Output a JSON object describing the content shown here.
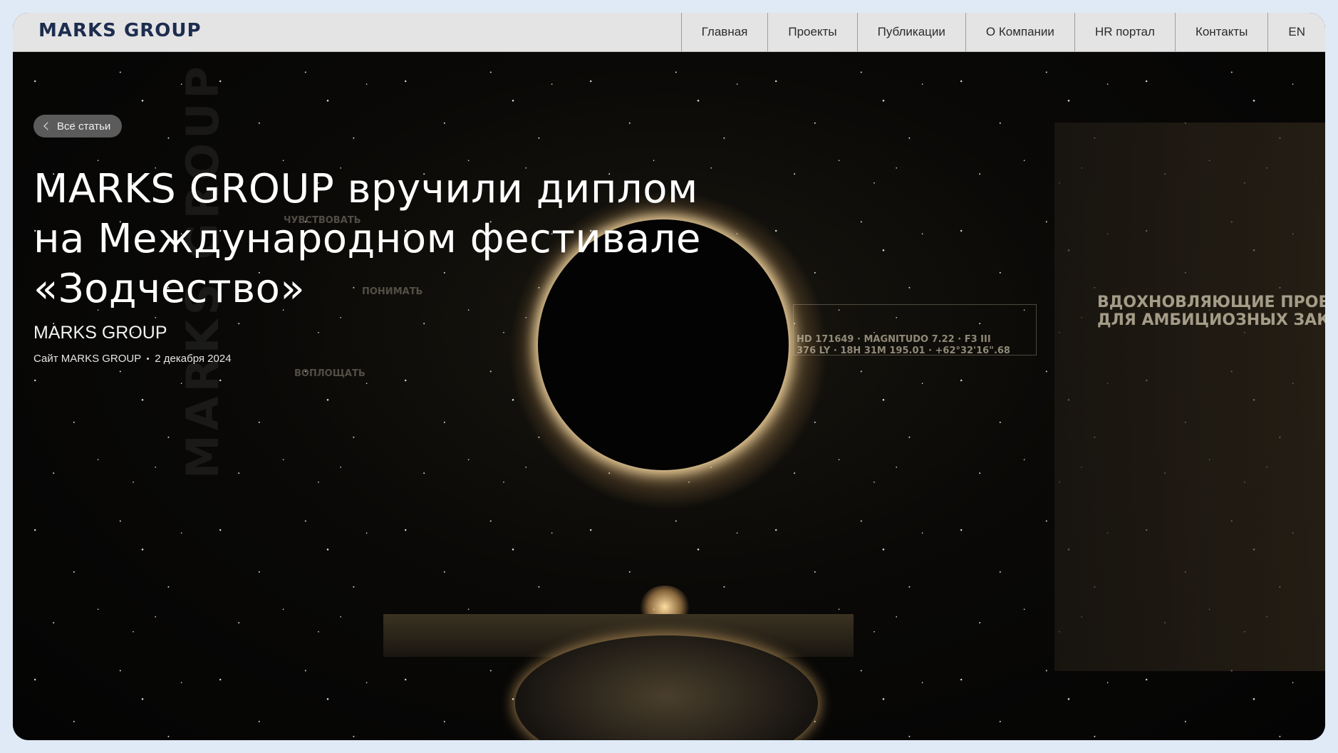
{
  "header": {
    "logo": "MARKS GROUP",
    "nav": [
      {
        "label": "Главная"
      },
      {
        "label": "Проекты"
      },
      {
        "label": "Публикации"
      },
      {
        "label": "О Компании"
      },
      {
        "label": "HR портал"
      },
      {
        "label": "Контакты"
      },
      {
        "label": "EN"
      }
    ]
  },
  "article": {
    "back_label": "Все статьи",
    "back_icon": "chevron-left-icon",
    "title_lines": [
      "MARKS GROUP вручили диплом",
      "на Международном фестивале",
      "«Зодчество»"
    ],
    "author": "MARKS GROUP",
    "source": "Сайт MARKS GROUP",
    "date": "2 декабря 2024"
  },
  "hero_scene": {
    "vertical_logo": "MARKS GROUP",
    "wall_words": [
      "ЧУВСТВОВАТЬ",
      "ПОНИМАТЬ",
      "ВОПЛОЩАТЬ"
    ],
    "hud_lines": [
      "HD 171649 · MAGNITUDO 7.22 · F3 III",
      "376 LY · 18H 31M 195.01 · +62°32'16\".68"
    ],
    "sign_lines": [
      "ВДОХНОВЛЯЮЩИЕ ПРОЕ",
      "ДЛЯ АМБИЦИОЗНЫХ ЗАК"
    ]
  },
  "colors": {
    "page_bg": "#dfeaf6",
    "header_bg": "#e4e4e4",
    "logo": "#1d2d4f",
    "accent_glow": "#ffe2a0"
  }
}
